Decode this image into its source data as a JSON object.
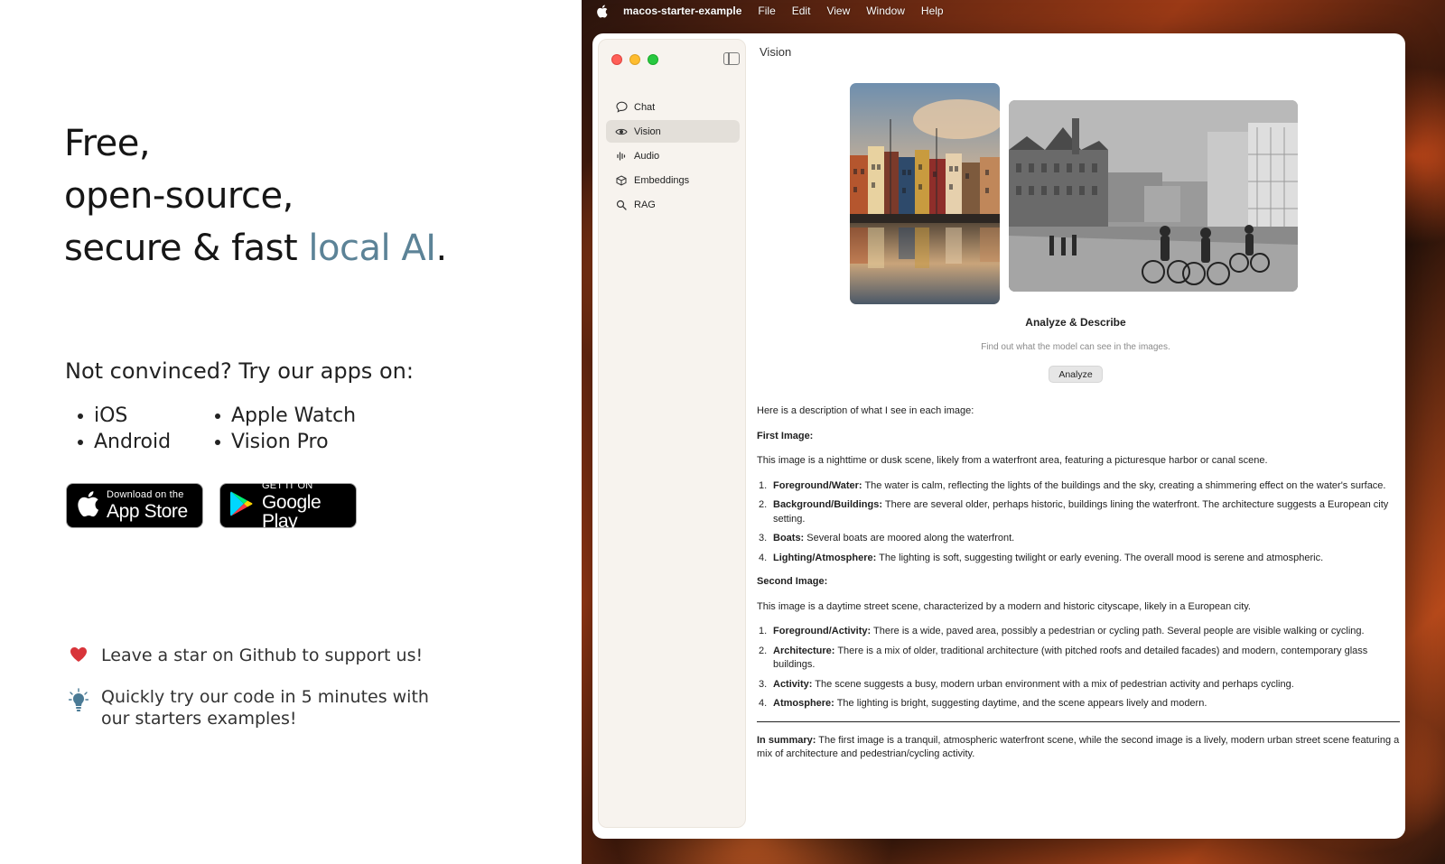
{
  "promo": {
    "headline_line1": "Free,",
    "headline_line2": "open-source,",
    "headline_line3_prefix": "secure & fast ",
    "headline_line3_accent": "local AI",
    "headline_line3_suffix": ".",
    "accent_color": "#5c8397",
    "pitch": "Not convinced? Try our apps on:",
    "platforms": [
      "iOS",
      "Apple Watch",
      "Android",
      "Vision Pro"
    ],
    "app_store": {
      "small": "Download on the",
      "big": "App Store"
    },
    "google_play": {
      "small": "GET IT ON",
      "big": "Google Play"
    },
    "notes": [
      {
        "icon": "heart-icon",
        "text": "Leave a star on Github to support us!"
      },
      {
        "icon": "lightbulb-icon",
        "text": "Quickly try our code in 5 minutes with our starters examples!"
      }
    ]
  },
  "menubar": {
    "app_name": "macos-starter-example",
    "items": [
      "File",
      "Edit",
      "View",
      "Window",
      "Help"
    ]
  },
  "sidebar": {
    "items": [
      {
        "label": "Chat",
        "icon": "chat-bubble-icon"
      },
      {
        "label": "Vision",
        "icon": "eye-icon",
        "active": true
      },
      {
        "label": "Audio",
        "icon": "waveform-icon"
      },
      {
        "label": "Embeddings",
        "icon": "cube-icon"
      },
      {
        "label": "RAG",
        "icon": "magnifier-icon"
      }
    ]
  },
  "content": {
    "title": "Vision",
    "analyze_title": "Analyze & Describe",
    "analyze_subtitle": "Find out what the model can see in the images.",
    "analyze_button": "Analyze",
    "intro": "Here is a description of what I see in each image:",
    "first_heading": "First Image:",
    "first_summary": "This image is a nighttime or dusk scene, likely from a waterfront area, featuring a picturesque harbor or canal scene.",
    "first_items": [
      {
        "num": "1.",
        "label": "Foreground/Water:",
        "text": " The water is calm, reflecting the lights of the buildings and the sky, creating a shimmering effect on the water's surface."
      },
      {
        "num": "2.",
        "label": "Background/Buildings:",
        "text": " There are several older, perhaps historic, buildings lining the waterfront. The architecture suggests a European city setting."
      },
      {
        "num": "3.",
        "label": "Boats:",
        "text": " Several boats are moored along the waterfront."
      },
      {
        "num": "4.",
        "label": "Lighting/Atmosphere:",
        "text": " The lighting is soft, suggesting twilight or early evening. The overall mood is serene and atmospheric."
      }
    ],
    "second_heading": "Second Image:",
    "second_summary": "This image is a daytime street scene, characterized by a modern and historic cityscape, likely in a European city.",
    "second_items": [
      {
        "num": "1.",
        "label": "Foreground/Activity:",
        "text": " There is a wide, paved area, possibly a pedestrian or cycling path. Several people are visible walking or cycling."
      },
      {
        "num": "2.",
        "label": "Architecture:",
        "text": " There is a mix of older, traditional architecture (with pitched roofs and detailed facades) and modern, contemporary glass buildings."
      },
      {
        "num": "3.",
        "label": "Activity:",
        "text": " The scene suggests a busy, modern urban environment with a mix of pedestrian activity and perhaps cycling."
      },
      {
        "num": "4.",
        "label": "Atmosphere:",
        "text": " The lighting is bright, suggesting daytime, and the scene appears lively and modern."
      }
    ],
    "summary_label": "In summary:",
    "summary_text": " The first image is a tranquil, atmospheric waterfront scene, while the second image is a lively, modern urban street scene featuring a mix of architecture and pedestrian/cycling activity."
  }
}
